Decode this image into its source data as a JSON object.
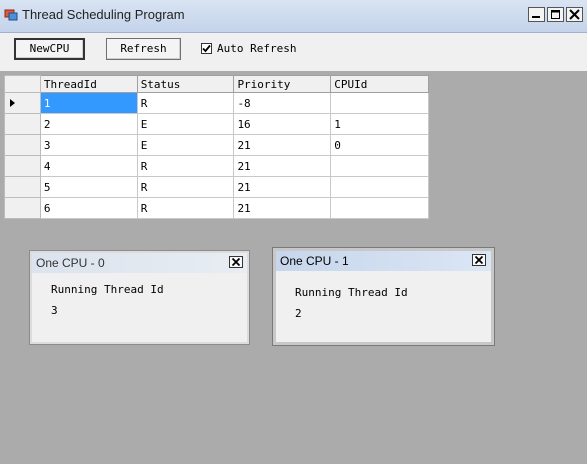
{
  "window": {
    "title": "Thread Scheduling Program"
  },
  "toolbar": {
    "new_cpu_label": "NewCPU",
    "refresh_label": "Refresh",
    "auto_refresh_label": "Auto Refresh",
    "auto_refresh_checked": true
  },
  "grid": {
    "columns": [
      "ThreadId",
      "Status",
      "Priority",
      "CPUId"
    ],
    "rows": [
      [
        "1",
        "R",
        "-8",
        ""
      ],
      [
        "2",
        "E",
        "16",
        "1"
      ],
      [
        "3",
        "E",
        "21",
        "0"
      ],
      [
        "4",
        "R",
        "21",
        ""
      ],
      [
        "5",
        "R",
        "21",
        ""
      ],
      [
        "6",
        "R",
        "21",
        ""
      ]
    ],
    "selected_row": 0
  },
  "cpu_windows": [
    {
      "title": "One CPU - 0",
      "label": "Running Thread Id",
      "thread_id": "3",
      "active": false
    },
    {
      "title": "One CPU - 1",
      "label": "Running Thread Id",
      "thread_id": "2",
      "active": true
    }
  ],
  "icons": {
    "app": "app-window-icon",
    "check": "✔",
    "close": "✕"
  }
}
